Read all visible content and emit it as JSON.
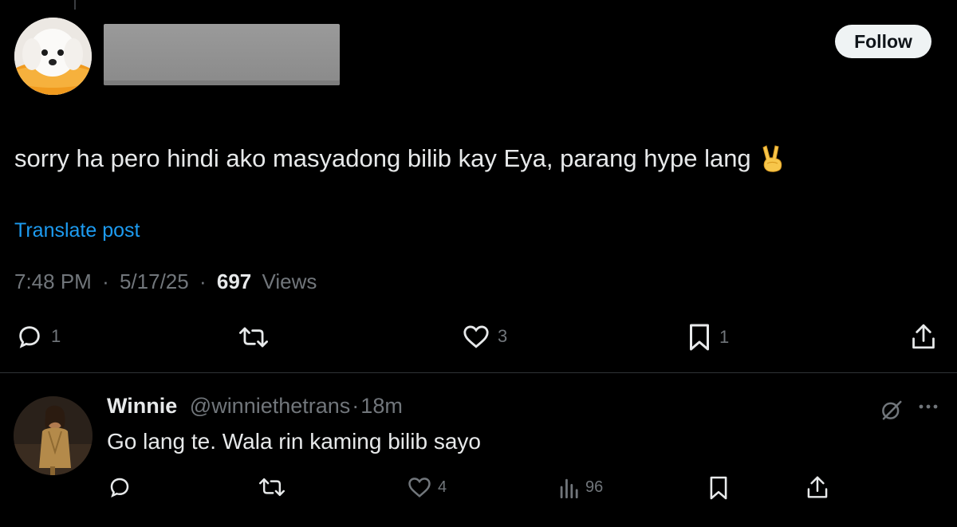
{
  "post": {
    "follow_label": "Follow",
    "text": "sorry ha pero hindi ako masyadong bilib kay Eya, parang hype lang",
    "translate_label": "Translate post",
    "time": "7:48 PM",
    "date": "5/17/25",
    "views_count": "697",
    "views_label": "Views",
    "sep": "·",
    "actions": {
      "replies": "1",
      "likes": "3",
      "bookmarks": "1"
    }
  },
  "reply": {
    "name": "Winnie",
    "handle": "@winniethetrans",
    "sep": "·",
    "time": "18m",
    "text": "Go lang te. Wala rin kaming bilib sayo",
    "actions": {
      "likes": "4",
      "views": "96"
    }
  },
  "icons": {
    "reply": "reply-bubble-icon",
    "repost": "repost-icon",
    "like": "heart-icon",
    "bookmark": "bookmark-icon",
    "share": "share-icon",
    "views": "analytics-icon",
    "grok": "grok-icon",
    "more": "more-icon",
    "victory_emoji": "victory-hand-emoji"
  },
  "colors": {
    "background": "#000000",
    "text": "#e7e9ea",
    "secondary": "#71767b",
    "link": "#1d9bf0",
    "divider": "#2f3336",
    "follow_bg": "#eff3f4"
  }
}
